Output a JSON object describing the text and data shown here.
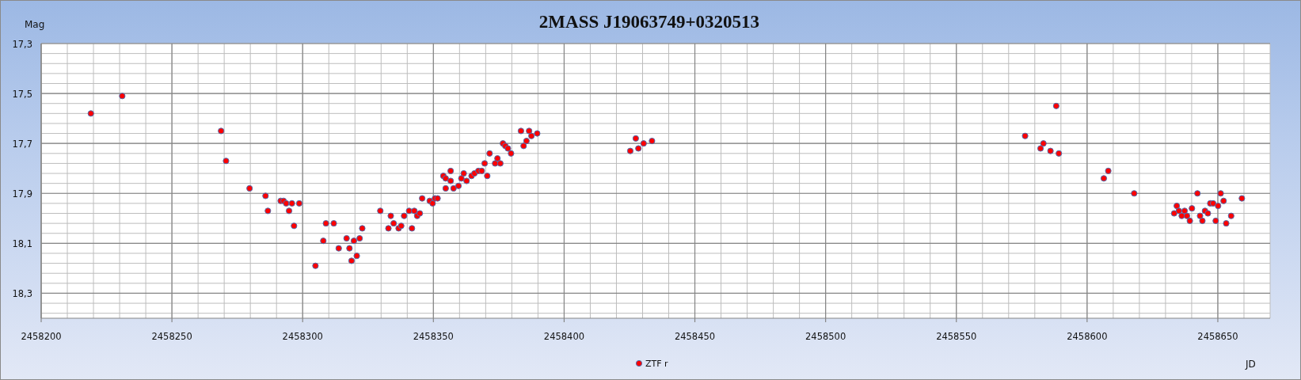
{
  "chart": {
    "chart_data": {
      "type": "scatter",
      "title": "2MASS J19063749+0320513",
      "xlabel": "JD",
      "ylabel": "Mag",
      "xlim": [
        2458200,
        2458670
      ],
      "ylim": [
        18.4,
        17.3
      ],
      "grid": true,
      "xticks": [
        2458200,
        2458250,
        2458300,
        2458350,
        2458400,
        2458450,
        2458500,
        2458550,
        2458600,
        2458650
      ],
      "yticks": [
        {
          "value": 17.3,
          "label": "17,3"
        },
        {
          "value": 17.5,
          "label": "17,5"
        },
        {
          "value": 17.7,
          "label": "17,7"
        },
        {
          "value": 17.9,
          "label": "17,9"
        },
        {
          "value": 18.1,
          "label": "18,1"
        },
        {
          "value": 18.3,
          "label": "18,3"
        }
      ],
      "x": [
        2458219.0,
        2458231.0,
        2458268.8,
        2458270.7,
        2458279.7,
        2458285.8,
        2458286.7,
        2458291.6,
        2458292.7,
        2458293.7,
        2458295.9,
        2458294.8,
        2458298.7,
        2458296.7,
        2458304.9,
        2458307.9,
        2458308.9,
        2458311.9,
        2458313.8,
        2458316.8,
        2458317.9,
        2458318.7,
        2458319.6,
        2458320.7,
        2458321.8,
        2458322.8,
        2458329.7,
        2458332.8,
        2458333.7,
        2458334.8,
        2458336.7,
        2458337.7,
        2458338.8,
        2458340.7,
        2458341.8,
        2458342.7,
        2458343.8,
        2458344.8,
        2458345.7,
        2458348.6,
        2458349.7,
        2458350.6,
        2458351.6,
        2458353.8,
        2458354.7,
        2458354.7,
        2458356.6,
        2458356.6,
        2458357.7,
        2458359.6,
        2458360.7,
        2458361.6,
        2458362.7,
        2458364.6,
        2458365.7,
        2458367.2,
        2458368.5,
        2458369.6,
        2458370.6,
        2458371.5,
        2458373.6,
        2458374.5,
        2458375.6,
        2458376.6,
        2458377.5,
        2458378.5,
        2458379.7,
        2458383.5,
        2458384.5,
        2458385.6,
        2458386.6,
        2458387.5,
        2458389.7,
        2458425.3,
        2458427.4,
        2458428.4,
        2458430.4,
        2458433.6,
        2458576.3,
        2458588.2,
        2458582.2,
        2458583.3,
        2458586.0,
        2458589.2,
        2458606.4,
        2458608.1,
        2458618.0,
        2458633.3,
        2458634.3,
        2458635.1,
        2458636.2,
        2458637.3,
        2458638.2,
        2458639.3,
        2458640.1,
        2458642.2,
        2458643.2,
        2458644.1,
        2458645.1,
        2458646.2,
        2458647.1,
        2458648.2,
        2458649.2,
        2458650.1,
        2458651.1,
        2458652.2,
        2458653.2,
        2458655.1,
        2458659.2
      ],
      "series": [
        {
          "name": "ZTF r",
          "color": "#ff0000",
          "values": [
            17.58,
            17.51,
            17.65,
            17.77,
            17.88,
            17.91,
            17.97,
            17.93,
            17.93,
            17.94,
            17.94,
            17.97,
            17.94,
            18.03,
            18.19,
            18.09,
            18.02,
            18.02,
            18.12,
            18.08,
            18.12,
            18.17,
            18.09,
            18.15,
            18.08,
            18.04,
            17.97,
            18.04,
            17.99,
            18.02,
            18.04,
            18.03,
            17.99,
            17.97,
            18.04,
            17.97,
            17.99,
            17.98,
            17.92,
            17.93,
            17.94,
            17.92,
            17.92,
            17.83,
            17.84,
            17.88,
            17.81,
            17.85,
            17.88,
            17.87,
            17.84,
            17.82,
            17.85,
            17.83,
            17.82,
            17.81,
            17.81,
            17.78,
            17.83,
            17.74,
            17.78,
            17.76,
            17.78,
            17.7,
            17.71,
            17.72,
            17.74,
            17.65,
            17.71,
            17.69,
            17.65,
            17.67,
            17.66,
            17.73,
            17.68,
            17.72,
            17.7,
            17.69,
            17.67,
            17.55,
            17.72,
            17.7,
            17.73,
            17.74,
            17.84,
            17.81,
            17.9,
            17.98,
            17.95,
            17.97,
            17.99,
            17.97,
            17.99,
            18.01,
            17.96,
            17.9,
            17.99,
            18.01,
            17.97,
            17.98,
            17.94,
            17.94,
            18.01,
            17.95,
            17.9,
            17.93,
            18.02,
            17.99,
            17.92
          ]
        }
      ]
    }
  }
}
